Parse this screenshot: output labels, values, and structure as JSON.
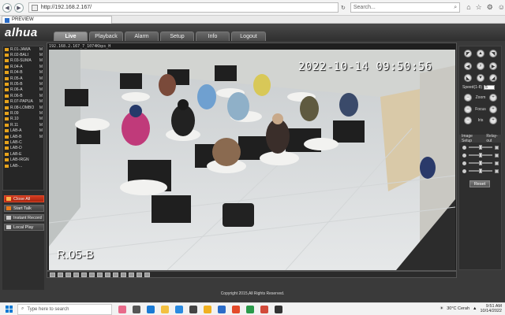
{
  "browser": {
    "url": "http://192.168.2.167/",
    "search_placeholder": "Search...",
    "tab_title": "PREVIEW"
  },
  "app": {
    "logo": "alhua",
    "nav": [
      "Live",
      "Playback",
      "Alarm",
      "Setup",
      "Info",
      "Logout"
    ],
    "active_nav": "Live"
  },
  "channels": [
    {
      "label": "R.01-JAWA",
      "m": "M"
    },
    {
      "label": "R.02-BALI",
      "m": "M"
    },
    {
      "label": "R.03-SUMA",
      "m": "M"
    },
    {
      "label": "R.04-A",
      "m": "M"
    },
    {
      "label": "R.04-B",
      "m": "M"
    },
    {
      "label": "R.05-A",
      "m": "M"
    },
    {
      "label": "R.05-B",
      "m": "M"
    },
    {
      "label": "R.06-A",
      "m": "M"
    },
    {
      "label": "R.06-B",
      "m": "M"
    },
    {
      "label": "R.07-PAPUA",
      "m": "M"
    },
    {
      "label": "R.08-LOMBO",
      "m": "M"
    },
    {
      "label": "R.09",
      "m": "M"
    },
    {
      "label": "R.10",
      "m": "M"
    },
    {
      "label": "R.11",
      "m": "M"
    },
    {
      "label": "LAB-A",
      "m": "M"
    },
    {
      "label": "LAB-B",
      "m": "M"
    },
    {
      "label": "LAB-C",
      "m": ""
    },
    {
      "label": "LAB-D",
      "m": ""
    },
    {
      "label": "LAB-E",
      "m": ""
    },
    {
      "label": "LAB-IRGN",
      "m": ""
    },
    {
      "label": "LAB-...",
      "m": ""
    }
  ],
  "left_buttons": {
    "close_all": "Close All",
    "start_talk": "Start Talk",
    "instant_record": "Instant Record",
    "local_play": "Local Play"
  },
  "video": {
    "info": "192.168.2.167_7_1074Kbps_H",
    "timestamp": "2022-10-14  09:50:56",
    "camera_name": "R.05-B"
  },
  "ptz": {
    "speed_label": "Speed(1-8)",
    "speed_value": "5",
    "zoom_label": "Zoom",
    "focus_label": "Focus",
    "iris_label": "Iris"
  },
  "image_setup": {
    "tab1": "Image Setup",
    "tab2": "Relay-out",
    "sliders": [
      {
        "name": "brightness",
        "value": 0.5
      },
      {
        "name": "contrast",
        "value": 0.5
      },
      {
        "name": "hue",
        "value": 0.5
      },
      {
        "name": "saturation",
        "value": 0.5
      }
    ],
    "reset_label": "Reset"
  },
  "footer": "Copyright 2015,All Rights Reserved.",
  "taskbar": {
    "search_placeholder": "Type here to search",
    "weather": "30°C  Cerah",
    "time": "9:51 AM",
    "date": "10/14/2022"
  }
}
